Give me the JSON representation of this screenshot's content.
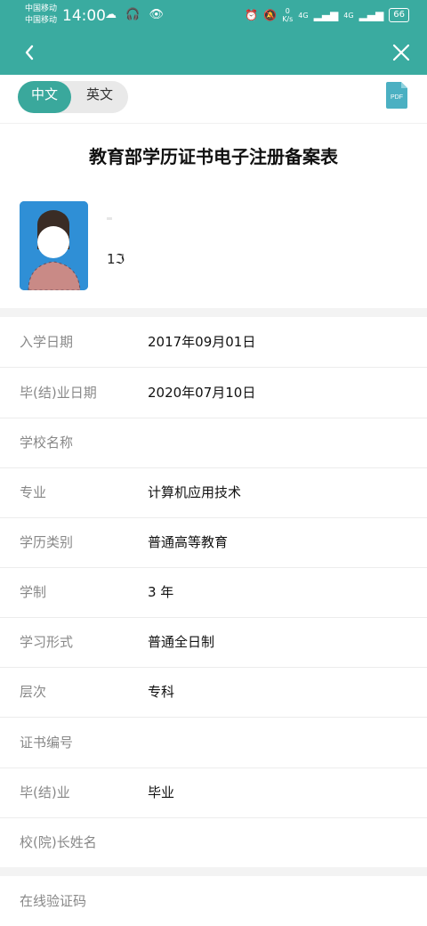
{
  "status_bar": {
    "carrier_1": "中国移动",
    "carrier_2": "中国移动",
    "time": "14:00",
    "icons": "☁ 🎧 👁",
    "speed_value": "0",
    "speed_unit": "K/s",
    "net_1": "4G",
    "net_2": "4G",
    "battery": "66"
  },
  "nav": {
    "back_icon": "chevron-left-icon",
    "close_icon": "close-icon"
  },
  "lang_toggle": {
    "chinese": "中文",
    "english": "英文"
  },
  "pdf_label": "PDF",
  "title": "教育部学历证书电子注册备案表",
  "profile_partial_text": "1ℑ",
  "fields": [
    {
      "label": "入学日期",
      "value": "2017年09月01日"
    },
    {
      "label": "毕(结)业日期",
      "value": "2020年07月10日"
    },
    {
      "label": "学校名称",
      "value": ""
    },
    {
      "label": "专业",
      "value": "计算机应用技术"
    },
    {
      "label": "学历类别",
      "value": "普通高等教育"
    },
    {
      "label": "学制",
      "value": "3 年"
    },
    {
      "label": "学习形式",
      "value": "普通全日制"
    },
    {
      "label": "层次",
      "value": "专科"
    },
    {
      "label": "证书编号",
      "value": ""
    },
    {
      "label": "毕(结)业",
      "value": "毕业"
    },
    {
      "label": "校(院)长姓名",
      "value": ""
    }
  ],
  "verify_label": "在线验证码",
  "colors": {
    "primary": "#3aaba0",
    "toggle_active": "#3aa89c",
    "pdf_icon": "#4bb0c2"
  }
}
